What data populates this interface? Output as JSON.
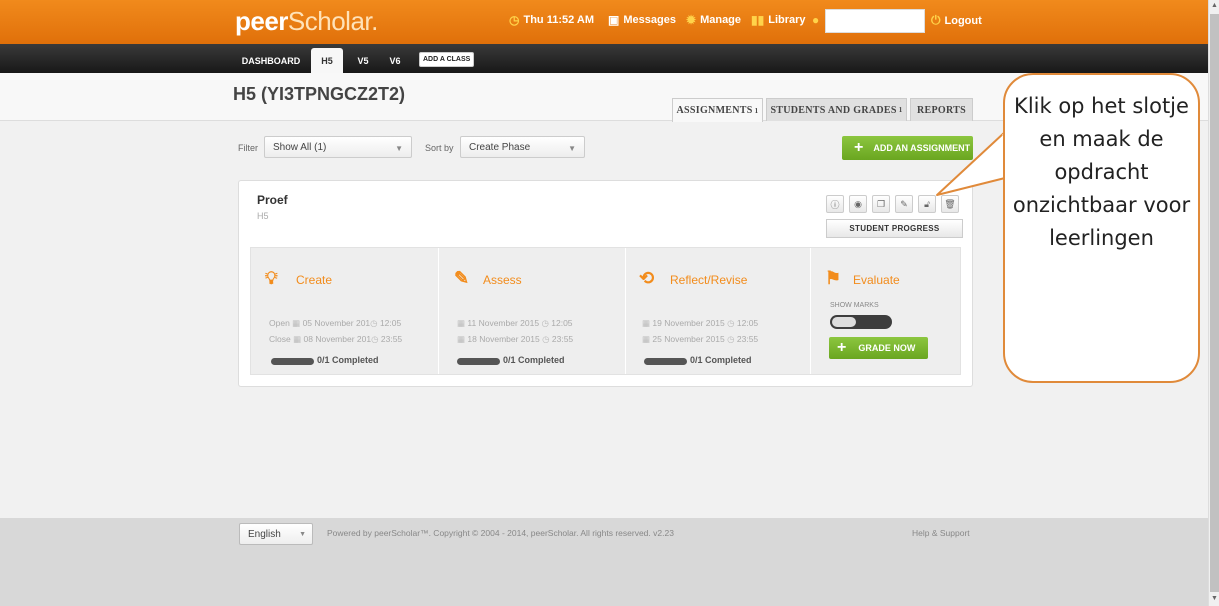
{
  "topbar": {
    "logo_peer": "peer",
    "logo_scholar": "Scholar.",
    "time": "Thu 11:52 AM",
    "messages": "Messages",
    "manage": "Manage",
    "library": "Library",
    "logout": "Logout",
    "icons": [
      "clock-icon",
      "message-icon",
      "gear-icon",
      "library-icon",
      "user-icon",
      "power-icon"
    ]
  },
  "class_tabs": {
    "dashboard": "DASHBOARD",
    "h5": "H5",
    "v5": "V5",
    "v6": "V6",
    "add_class": "ADD A CLASS"
  },
  "page": {
    "title": "H5 (YI3TPNGCZ2T2)",
    "tabs": [
      {
        "label": "ASSIGNMENTS",
        "count": "1"
      },
      {
        "label": "STUDENTS AND GRADES",
        "count": "1"
      },
      {
        "label": "REPORTS",
        "count": ""
      }
    ]
  },
  "filters": {
    "filter_label": "Filter",
    "filter_value": "Show All (1)",
    "sort_label": "Sort by",
    "sort_value": "Create Phase",
    "add_assignment": "ADD AN ASSIGNMENT"
  },
  "assignment": {
    "title": "Proef",
    "class": "H5",
    "student_progress": "STUDENT PROGRESS",
    "action_icons": [
      "info-icon",
      "eye-icon",
      "copy-icon",
      "edit-icon",
      "lock-icon",
      "trash-icon"
    ],
    "phases": {
      "create": {
        "name": "Create",
        "open_label": "Open",
        "open_date": "05 November 201",
        "open_time": "12:05",
        "close_label": "Close",
        "close_date": "08 November 201",
        "close_time": "23:55",
        "completed": "0/1 Completed"
      },
      "assess": {
        "name": "Assess",
        "open_date": "11 November 2015",
        "open_time": "12:05",
        "close_date": "18 November 2015",
        "close_time": "23:55",
        "completed": "0/1 Completed"
      },
      "reflect": {
        "name": "Reflect/Revise",
        "open_date": "19 November 2015",
        "open_time": "12:05",
        "close_date": "25 November 2015",
        "close_time": "23:55",
        "completed": "0/1 Completed"
      },
      "evaluate": {
        "name": "Evaluate",
        "show_marks": "SHOW MARKS",
        "grade_now": "GRADE NOW"
      }
    }
  },
  "footer": {
    "language": "English",
    "copyright": "Powered by peerScholar™. Copyright © 2004 - 2014, peerScholar. All rights reserved. v2.23",
    "help": "Help & Support"
  },
  "callout": {
    "text": "Klik op het slotje en maak de opdracht onzichtbaar voor leerlingen"
  },
  "colors": {
    "brand_orange": "#e8780f",
    "accent_green": "#7bb82e",
    "callout_border": "#e08a3a"
  }
}
